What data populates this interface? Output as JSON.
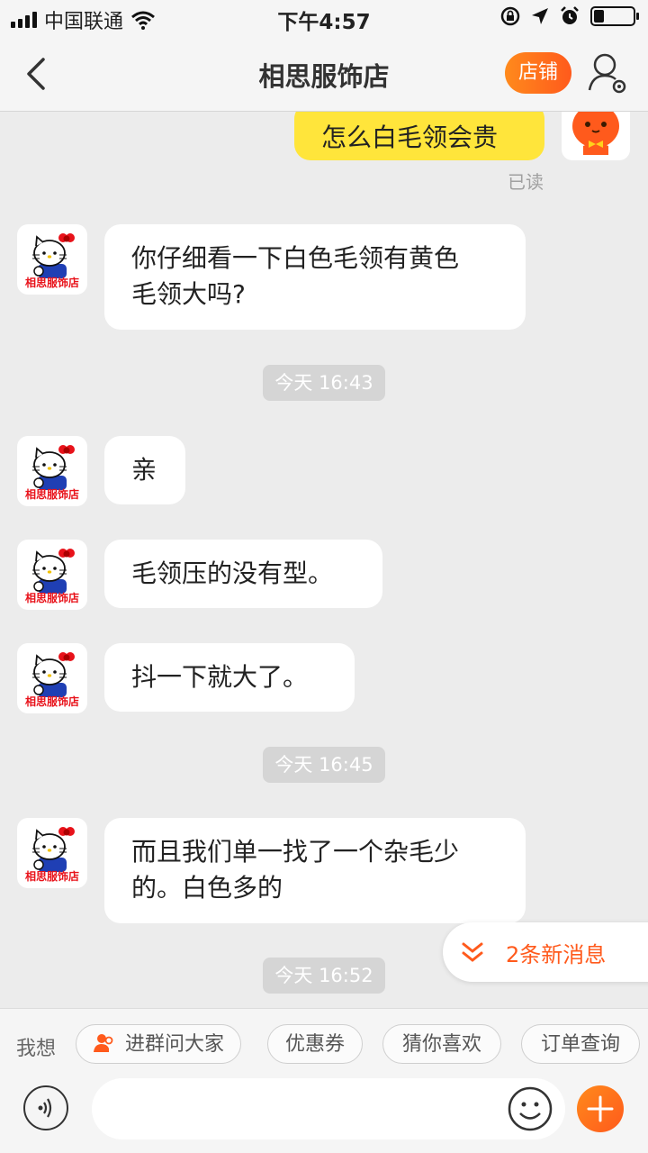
{
  "status_bar": {
    "carrier": "中国联通",
    "time": "下午4:57",
    "battery_level": 0.25
  },
  "nav": {
    "title": "相思服饰店",
    "shop_button": "店铺"
  },
  "messages": {
    "out_1": "怎么白毛领会贵",
    "read_label": "已读",
    "in_1_line1": "你仔细看一下白色毛领有黄色",
    "in_1_line2": "毛领大吗?",
    "time_1": "今天 16:43",
    "in_2": "亲",
    "in_3": "毛领压的没有型。",
    "in_4": "抖一下就大了。",
    "time_2": "今天 16:45",
    "in_5_line1": "而且我们单一找了一个杂毛少",
    "in_5_line2": "的。白色多的",
    "time_3": "今天 16:52"
  },
  "avatar_caption": "相思服饰店",
  "new_messages": "2条新消息",
  "quick_actions": {
    "label": "我想",
    "items": [
      "进群问大家",
      "优惠券",
      "猜你喜欢",
      "订单查询"
    ]
  },
  "colors": {
    "accent": "#ff5a1c",
    "bubble_out": "#ffe53b"
  }
}
